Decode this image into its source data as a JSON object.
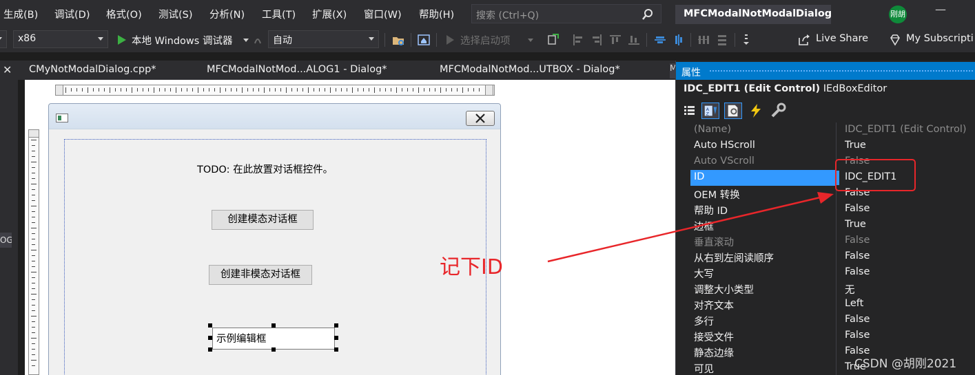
{
  "menu": {
    "items": [
      "生成(B)",
      "调试(D)",
      "格式(O)",
      "测试(S)",
      "分析(N)",
      "工具(T)",
      "扩展(X)",
      "窗口(W)",
      "帮助(H)"
    ],
    "search_placeholder": "搜索 (Ctrl+Q)",
    "app_title": "MFCModalNotModalDialog",
    "avatar_text": "刚胡"
  },
  "toolbar": {
    "platform": "x86",
    "debugger_label": "本地 Windows 调试器",
    "config": "自动",
    "startup_item": "选择启动项",
    "live_share": "Live Share",
    "subscription": "My Subscripti"
  },
  "left_strip": {
    "close": "✕",
    "tab_fragment": "OG"
  },
  "tabs": [
    {
      "label": "CMyNotModalDialog.cpp*"
    },
    {
      "label": "MFCModalNotMod...ALOG1 - Dialog*"
    },
    {
      "label": "MFCModalNotMod...UTBOX - Dialog*"
    }
  ],
  "dialog": {
    "todo": "TODO: 在此放置对话框控件。",
    "btn_modal": "创建模态对话框",
    "btn_nonmodal": "创建非模态对话框",
    "edit_text": "示例编辑框"
  },
  "annotation": {
    "text": "记下ID",
    "color": "#e8262a"
  },
  "properties": {
    "header": "属性",
    "selected_id": "IDC_EDIT1 (Edit Control)",
    "selected_editor": "IEdBoxEditor",
    "rows": [
      {
        "name": "(Name)",
        "value": "IDC_EDIT1 (Edit Control)",
        "dim": true
      },
      {
        "name": "Auto HScroll",
        "value": "True"
      },
      {
        "name": "Auto VScroll",
        "value": "False",
        "dim": true
      },
      {
        "name": "ID",
        "value": "IDC_EDIT1",
        "selected": true
      },
      {
        "name": "OEM 转换",
        "value": "False"
      },
      {
        "name": "帮助 ID",
        "value": "False"
      },
      {
        "name": "边框",
        "value": "True"
      },
      {
        "name": "垂直滚动",
        "value": "False",
        "dim": true
      },
      {
        "name": "从右到左阅读顺序",
        "value": "False"
      },
      {
        "name": "大写",
        "value": "False"
      },
      {
        "name": "调整大小类型",
        "value": "无"
      },
      {
        "name": "对齐文本",
        "value": "Left"
      },
      {
        "name": "多行",
        "value": "False"
      },
      {
        "name": "接受文件",
        "value": "False"
      },
      {
        "name": "静态边缘",
        "value": "False"
      },
      {
        "name": "可见",
        "value": "True"
      }
    ]
  },
  "watermark": "CSDN @胡刚2021",
  "colors": {
    "accent": "#007acc",
    "selection": "#3399ff",
    "annotation": "#e8262a"
  }
}
